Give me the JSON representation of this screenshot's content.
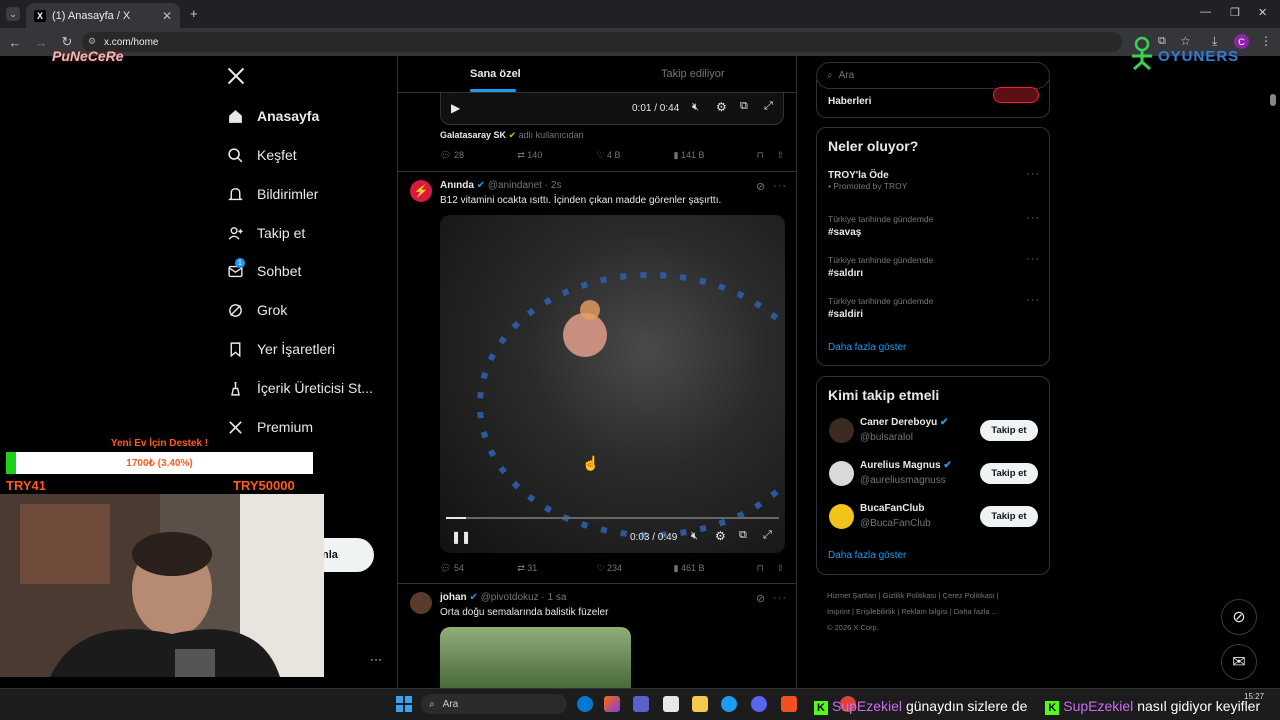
{
  "browser": {
    "tab_title": "(1) Anasayfa / X",
    "tab_favicon": "X",
    "url": "x.com/home",
    "profile_initial": "C"
  },
  "overlays": {
    "logo_left": "PuNeCeRe",
    "logo_right": "OYUNERS",
    "donation_title": "Yeni Ev İçin Destek !",
    "donation_progress_text": "1700₺ (3.40%)",
    "donation_progress": 0.034,
    "donation_min": "TRY41",
    "donation_max": "TRY50000",
    "post_button_partial": "nla",
    "more_dots": "···",
    "chat_line": [
      {
        "user": "SupEzekiel",
        "text": "günaydın sizlere de"
      },
      {
        "user": "SupEzekiel",
        "text": "nasıl gidiyor keyifler"
      }
    ]
  },
  "nav": {
    "items": [
      {
        "label": "Anasayfa",
        "icon": "home-icon",
        "active": true
      },
      {
        "label": "Keşfet",
        "icon": "search-icon"
      },
      {
        "label": "Bildirimler",
        "icon": "bell-icon"
      },
      {
        "label": "Takip et",
        "icon": "person-add-icon"
      },
      {
        "label": "Sohbet",
        "icon": "mail-icon",
        "badge": "1"
      },
      {
        "label": "Grok",
        "icon": "grok-icon"
      },
      {
        "label": "Yer İşaretleri",
        "icon": "bookmark-icon"
      },
      {
        "label": "İçerik Üreticisi St...",
        "icon": "creator-icon"
      },
      {
        "label": "Premium",
        "icon": "x-logo-icon"
      }
    ]
  },
  "header": {
    "tab_for_you": "Sana özel",
    "tab_following": "Takip ediliyor"
  },
  "posts": [
    {
      "video_time": "0:01 / 0:44",
      "quote_source": "Galatasaray SK",
      "quote_suffix": "adlı kullanıcıdan",
      "replies": "28",
      "reposts": "140",
      "likes": "4 B",
      "views": "141 B"
    },
    {
      "name": "Anında",
      "handle": "@anindanet",
      "time": "· 2s",
      "text": "B12 vitamini ocakta ısıttı. İçinden çıkan madde görenler şaşırttı.",
      "video_time": "0:03 / 0:49",
      "video_progress": 0.06,
      "replies": "54",
      "reposts": "31",
      "likes": "234",
      "views": "461 B"
    },
    {
      "name": "johan",
      "handle": "@pivotdokuz",
      "time": "· 1 sa",
      "text": "Orta doğu semalarında balistik füzeler"
    }
  ],
  "right": {
    "search_placeholder": "Ara",
    "partial_card_title": "Haberleri",
    "trending_title": "Neler oluyor?",
    "trends": [
      {
        "name": "TROY'la Öde",
        "sub": "Promoted by TROY",
        "promoted": true
      },
      {
        "label": "Türkiye tarihinde gündemde",
        "name": "#savaş"
      },
      {
        "label": "Türkiye tarihinde gündemde",
        "name": "#saldırı"
      },
      {
        "label": "Türkiye tarihinde gündemde",
        "name": "#saldiri"
      }
    ],
    "show_more": "Daha fazla göster",
    "who_to_follow_title": "Kimi takip etmeli",
    "follow_suggestions": [
      {
        "name": "Caner Dereboyu",
        "handle": "@bulsaralol",
        "verified": true
      },
      {
        "name": "Aurelius Magnus",
        "handle": "@aureliusmagnuss",
        "verified": true
      },
      {
        "name": "BucaFanClub",
        "handle": "@BucaFanClub",
        "verified": false
      }
    ],
    "follow_label": "Takip et",
    "footer_links": [
      "Hizmet Şartları",
      "Gizlilik Politikası",
      "Çerez Politikası",
      "Imprint",
      "Erişilebilirlik",
      "Reklam bilgisi",
      "Daha fazla ..."
    ],
    "copyright": "© 2026 X Corp."
  },
  "taskbar": {
    "search": "Ara",
    "time": "15:27"
  },
  "colors": {
    "accent": "#1d9bf0",
    "verified": "#1d9bf0",
    "donation_bar": "#1bd11b",
    "donation_title": "#ff5a1f"
  }
}
